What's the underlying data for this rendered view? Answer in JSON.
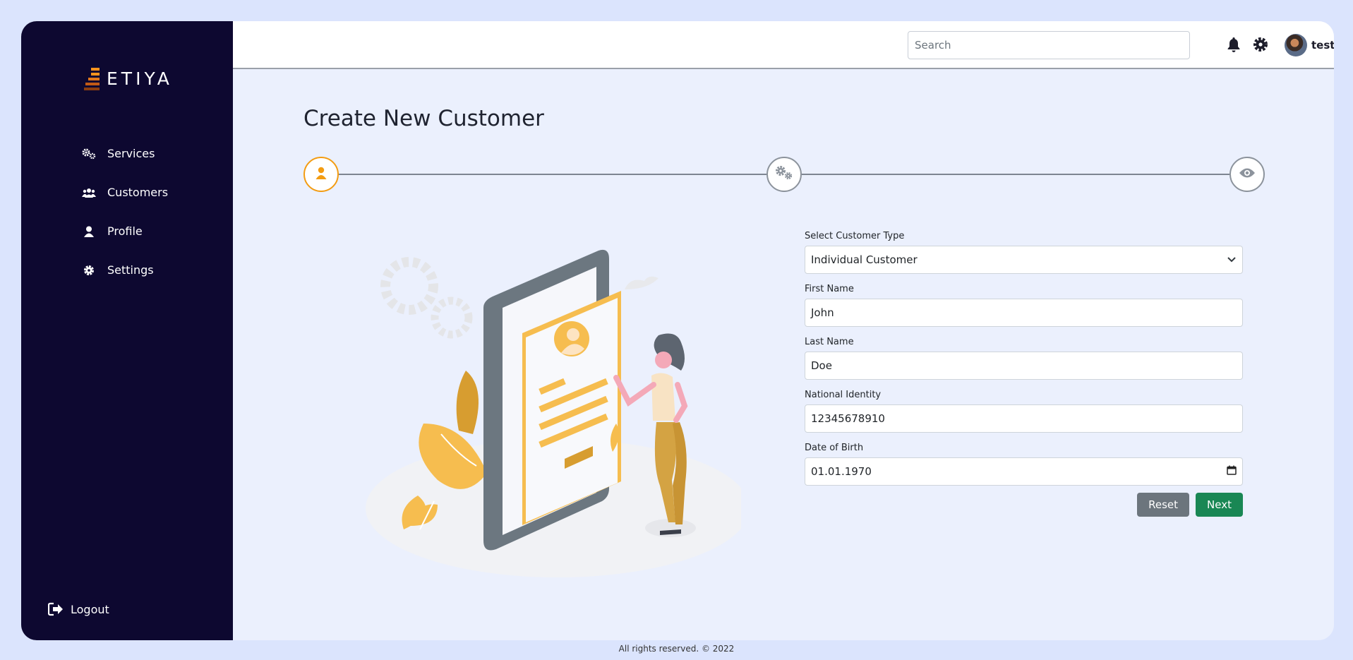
{
  "brand": {
    "name": "ETIYA"
  },
  "sidebar": {
    "items": [
      {
        "label": "Services",
        "icon": "gears-icon"
      },
      {
        "label": "Customers",
        "icon": "users-icon"
      },
      {
        "label": "Profile",
        "icon": "user-icon"
      },
      {
        "label": "Settings",
        "icon": "gear-icon"
      }
    ],
    "logout_label": "Logout"
  },
  "topbar": {
    "search_placeholder": "Search",
    "user_name": "test"
  },
  "page": {
    "title": "Create New Customer"
  },
  "stepper": {
    "steps": [
      {
        "icon": "user-icon",
        "state": "active"
      },
      {
        "icon": "gears-icon",
        "state": "inactive"
      },
      {
        "icon": "eye-icon",
        "state": "inactive"
      }
    ]
  },
  "form": {
    "customer_type_label": "Select Customer Type",
    "customer_type_value": "Individual Customer",
    "first_name_label": "First Name",
    "first_name_value": "John",
    "last_name_label": "Last Name",
    "last_name_value": "Doe",
    "national_identity_label": "National Identity",
    "national_identity_value": "12345678910",
    "dob_label": "Date of Birth",
    "dob_value": "01.01.1970",
    "reset_label": "Reset",
    "next_label": "Next"
  },
  "footer": {
    "text": "All rights reserved. © 2022"
  },
  "colors": {
    "sidebar_bg": "#0d0830",
    "accent": "#f39c12",
    "next_button": "#198754",
    "reset_button": "#6c757d",
    "page_bg": "#ebf0fd"
  }
}
